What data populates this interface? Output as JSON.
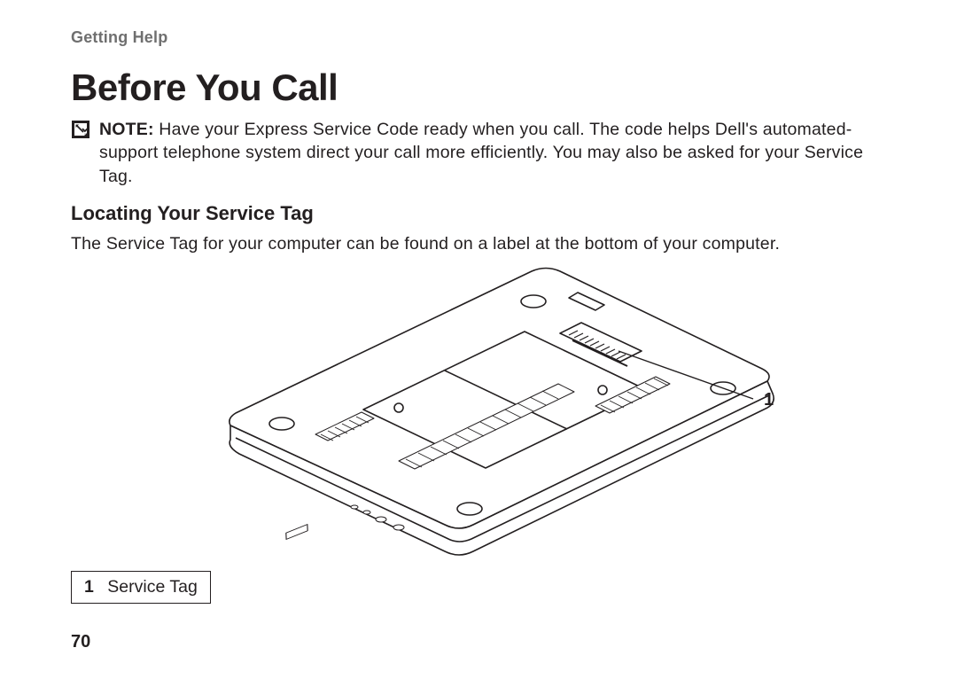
{
  "chapter": "Getting Help",
  "heading": "Before You Call",
  "note": {
    "label": "NOTE:",
    "text": " Have your Express Service Code ready when you call. The code helps Dell's automated-support telephone system direct your call more efficiently. You may also be asked for your Service Tag."
  },
  "subheading": "Locating Your Service Tag",
  "body": "The Service Tag for your computer can be found on a label at the bottom of your computer.",
  "callout": {
    "number": "1"
  },
  "legend": {
    "num": "1",
    "label": "Service Tag"
  },
  "page_number": "70"
}
